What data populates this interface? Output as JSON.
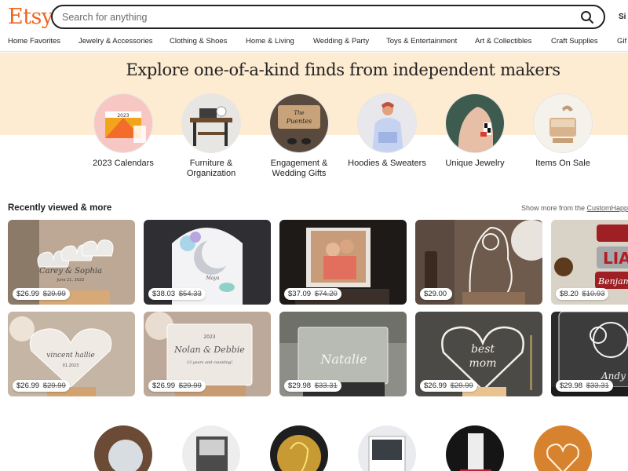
{
  "brand": {
    "logo_text": "Etsy",
    "color": "#F1641E"
  },
  "search": {
    "placeholder": "Search for anything",
    "value": ""
  },
  "header": {
    "signin_label": "Si"
  },
  "nav": {
    "items": [
      "Home Favorites",
      "Jewelry & Accessories",
      "Clothing & Shoes",
      "Home & Living",
      "Wedding & Party",
      "Toys & Entertainment",
      "Art & Collectibles",
      "Craft Supplies",
      "Gif"
    ]
  },
  "hero": {
    "title": "Explore one-of-a-kind finds from independent makers",
    "band_color": "#FDEBD2",
    "categories": [
      {
        "label": "2023 Calendars"
      },
      {
        "label": "Furniture & Organization"
      },
      {
        "label": "Engagement & Wedding Gifts"
      },
      {
        "label": "Hoodies & Sweaters"
      },
      {
        "label": "Unique Jewelry"
      },
      {
        "label": "Items On Sale"
      }
    ]
  },
  "recently_viewed": {
    "title": "Recently viewed & more",
    "more_prefix": "Show more from the ",
    "more_link": "CustomHapp",
    "items": [
      {
        "price": "$26.99",
        "old_price": "$29.99"
      },
      {
        "price": "$38.03",
        "old_price": "$54.33"
      },
      {
        "price": "$37.09",
        "old_price": "$74.20"
      },
      {
        "price": "$29.00",
        "old_price": ""
      },
      {
        "price": "$8.20",
        "old_price": "$10.93"
      },
      {
        "price": "$26.99",
        "old_price": "$29.99"
      },
      {
        "price": "$26.99",
        "old_price": "$29.99"
      },
      {
        "price": "$29.98",
        "old_price": "$33.31"
      },
      {
        "price": "$26.99",
        "old_price": "$29.99"
      },
      {
        "price": "$29.98",
        "old_price": "$33.31"
      }
    ],
    "image_labels": {
      "names_1": "Carey & Sophia",
      "names_1_date": "June 21, 2022",
      "moon_name": "Maya",
      "heart_names": "vincent hallie",
      "heart_date": "01.2023",
      "plaque_year": "2023",
      "plaque_names": "Nolan & Debbie",
      "plaque_sub": "13 years and counting!",
      "acrylic_name": "Natalie",
      "best_mom_1": "best",
      "best_mom_2": "mom",
      "sign_1": "LIA",
      "sign_2": "Benjamin",
      "ele_name": "Andy",
      "cal_year": "2023",
      "wed_sign_1": "The",
      "wed_sign_2": "Puentes"
    }
  }
}
